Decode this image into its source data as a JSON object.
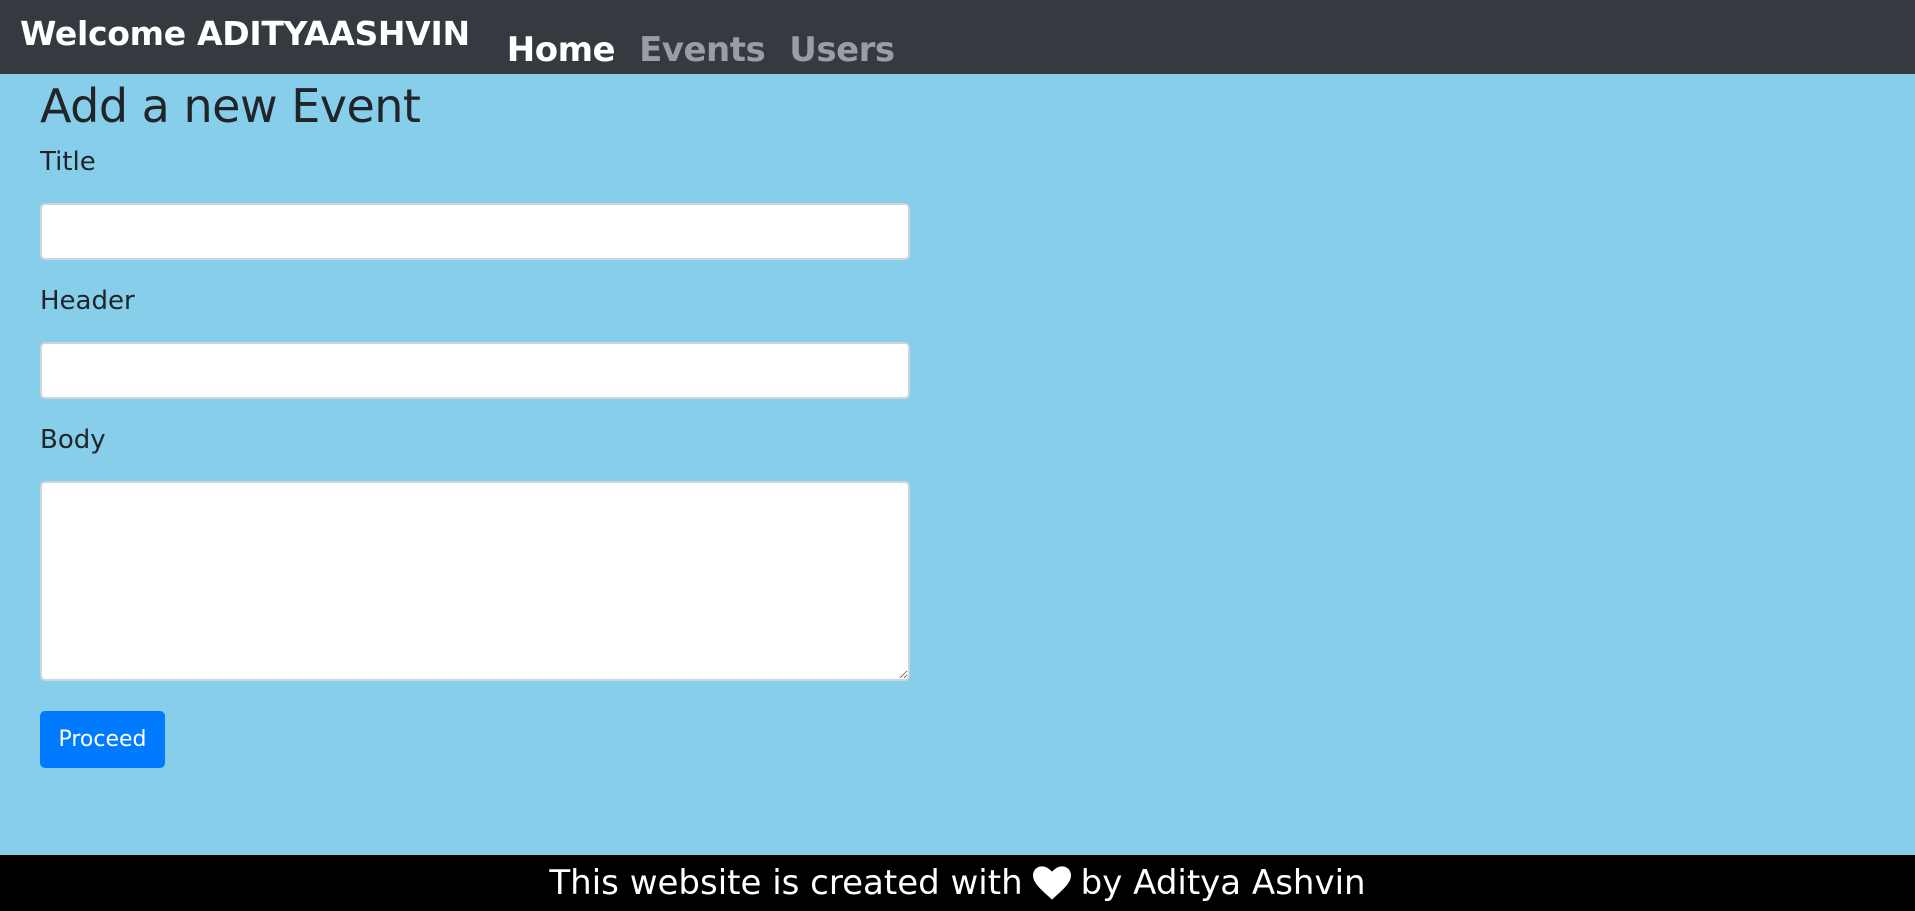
{
  "navbar": {
    "brand": "Welcome ADITYAASHVIN",
    "links": [
      {
        "label": "Home",
        "active": true
      },
      {
        "label": "Events",
        "active": false
      },
      {
        "label": "Users",
        "active": false
      }
    ]
  },
  "form": {
    "title": "Add a new Event",
    "fields": {
      "title_label": "Title",
      "title_value": "",
      "header_label": "Header",
      "header_value": "",
      "body_label": "Body",
      "body_value": ""
    },
    "submit_label": "Proceed"
  },
  "footer": {
    "text_before": "This website is created with",
    "icon": "heart-icon",
    "text_after": "by Aditya Ashvin"
  },
  "colors": {
    "page_background": "#87ceeb",
    "navbar_background": "#343a40",
    "primary_button": "#007bff",
    "footer_background": "#000000"
  }
}
